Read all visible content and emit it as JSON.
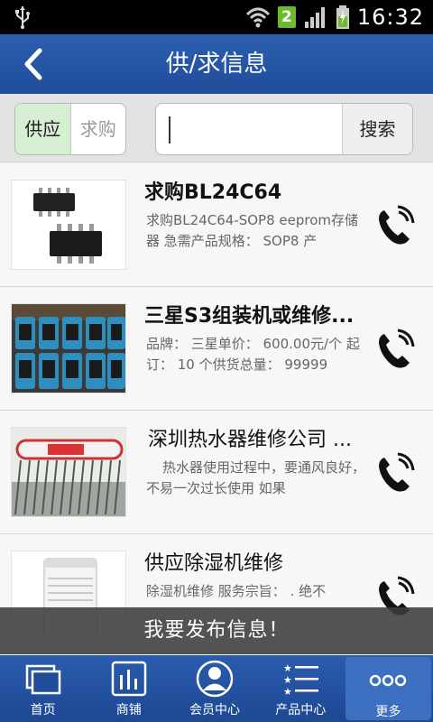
{
  "status_bar": {
    "time": "16:32",
    "sim": "2"
  },
  "header": {
    "title": "供/求信息"
  },
  "filter": {
    "options": [
      "供应",
      "求购"
    ],
    "search_placeholder": "",
    "search_button": "搜索"
  },
  "items": [
    {
      "title": "求购BL24C64",
      "desc": "求购BL24C64-SOP8 eeprom存储器 急需产品规格： SOP8 产"
    },
    {
      "title": "三星S3组装机或维修...",
      "desc": "品牌： 三星单价： 600.00元/个 起订： 10 个供货总量： 99999"
    },
    {
      "title": "深圳热水器维修公司 ...",
      "desc": "热水器使用过程中，要通风良好，不易一次过长使用 如果"
    },
    {
      "title": "供应除湿机维修",
      "desc": "除湿机维修 服务宗旨： . 绝不"
    }
  ],
  "banner": {
    "text": "我要发布信息！"
  },
  "nav": [
    {
      "label": "首页",
      "icon": "home-icon"
    },
    {
      "label": "商铺",
      "icon": "shop-icon"
    },
    {
      "label": "会员中心",
      "icon": "member-icon"
    },
    {
      "label": "产品中心",
      "icon": "product-list-icon"
    },
    {
      "label": "更多",
      "icon": "more-icon"
    }
  ],
  "colors": {
    "header": "#2a5cae",
    "active_tab": "#d6efd2"
  }
}
